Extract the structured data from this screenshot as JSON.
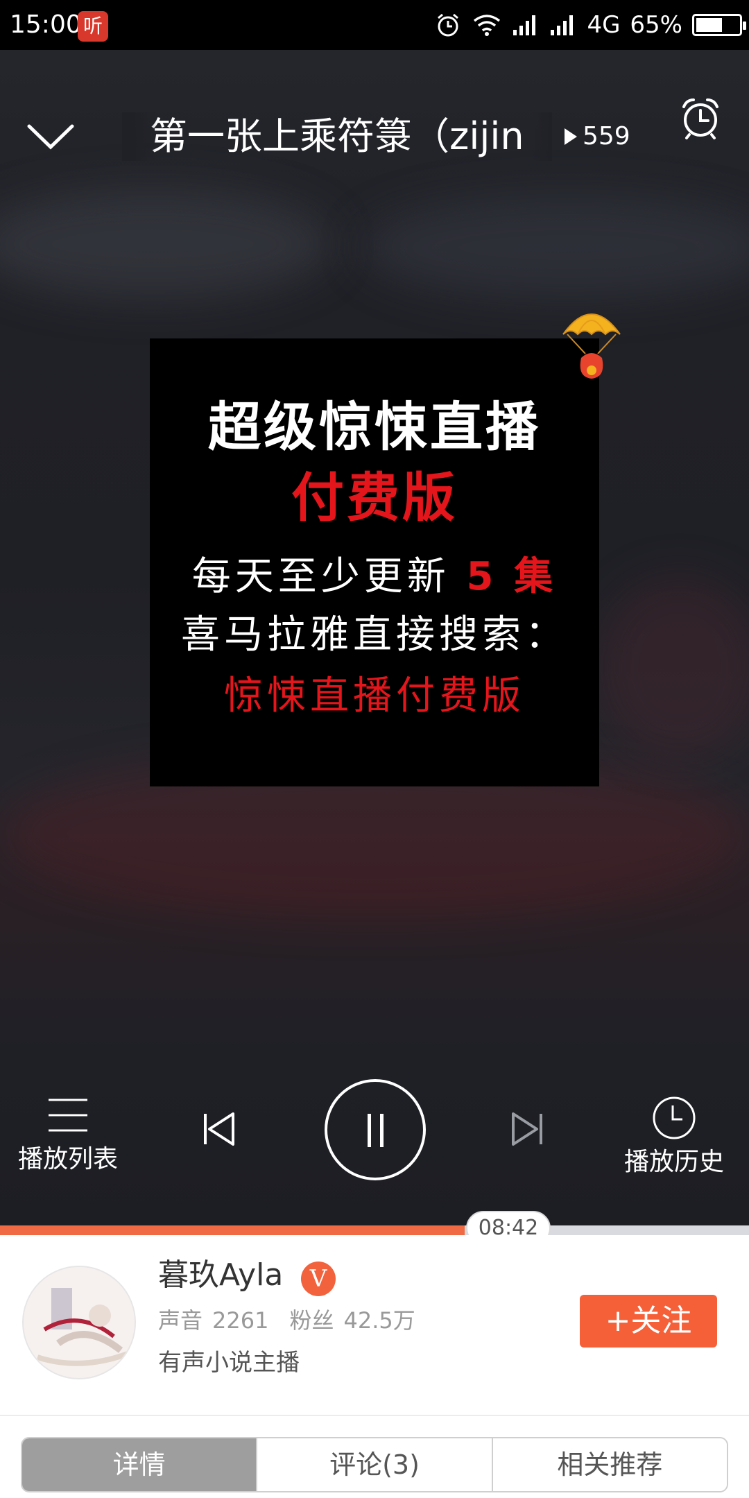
{
  "status_bar": {
    "time": "15:00",
    "app_icon": "听",
    "network": "4G",
    "battery": "65%",
    "battery_level": 0.65
  },
  "player": {
    "title": "第一张上乘符箓（zijin",
    "play_count": "559",
    "cover": {
      "line1": "超级惊悚直播",
      "line2": "付费版",
      "line3_prefix": "每天至少更新",
      "line3_number": "5",
      "line3_suffix": "集",
      "line4": "喜马拉雅直接搜索：",
      "line5": "惊悚直播付费版"
    },
    "controls": {
      "playlist_label": "播放列表",
      "history_label": "播放历史"
    },
    "progress": {
      "time": "08:42",
      "fraction": 0.62
    }
  },
  "anchor": {
    "name": "暮玖Ayla",
    "verified_badge": "V",
    "sounds_label": "声音",
    "sounds_value": "2261",
    "fans_label": "粉丝",
    "fans_value": "42.5万",
    "bio": "有声小说主播",
    "follow_label": "+关注"
  },
  "tabs": [
    {
      "label": "详情",
      "active": true
    },
    {
      "label": "评论(3)",
      "active": false
    },
    {
      "label": "相关推荐",
      "active": false
    }
  ],
  "colors": {
    "accent": "#f56039",
    "cover_red": "#e4151b"
  }
}
